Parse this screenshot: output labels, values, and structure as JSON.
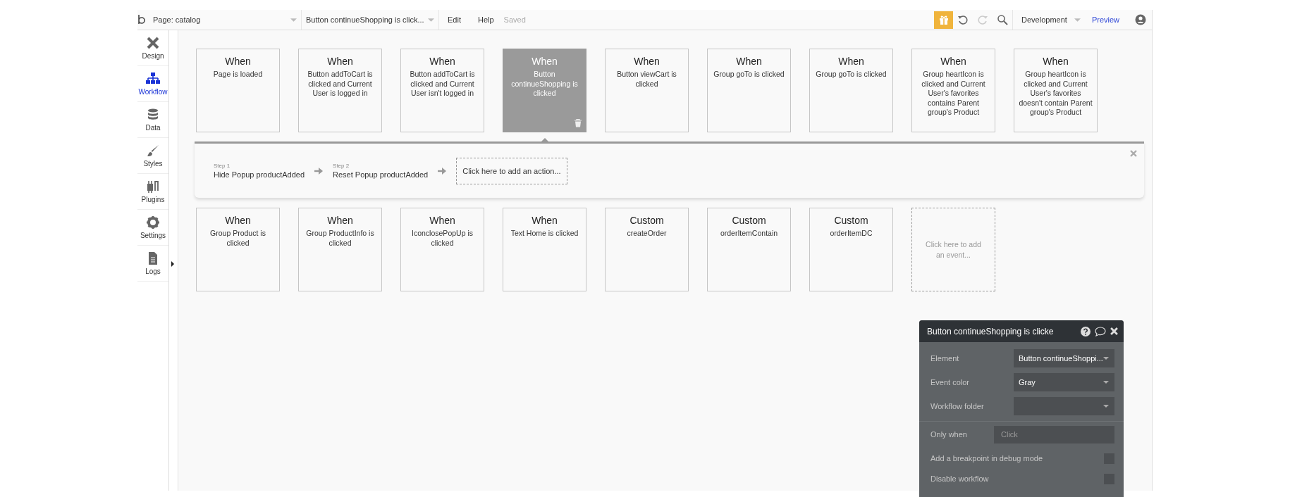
{
  "topbar": {
    "page_selector": "Page: catalog",
    "workflow_selector": "Button continueShopping is click...",
    "menu": [
      "Edit",
      "Help"
    ],
    "save_status": "Saved",
    "environment": "Development",
    "preview": "Preview"
  },
  "sidebar": {
    "items": [
      {
        "label": "Design",
        "selected": false
      },
      {
        "label": "Workflow",
        "selected": true
      },
      {
        "label": "Data",
        "selected": false
      },
      {
        "label": "Styles",
        "selected": false
      },
      {
        "label": "Plugins",
        "selected": false
      },
      {
        "label": "Settings",
        "selected": false
      },
      {
        "label": "Logs",
        "selected": false
      }
    ]
  },
  "event_rows": [
    {
      "events": [
        {
          "kind": "event",
          "heading": "When",
          "description": "Page is loaded",
          "selected": false
        },
        {
          "kind": "event",
          "heading": "When",
          "description": "Button addToCart is clicked and Current User is logged in",
          "selected": false
        },
        {
          "kind": "event",
          "heading": "When",
          "description": "Button addToCart is clicked and Current User isn't logged in",
          "selected": false
        },
        {
          "kind": "event",
          "heading": "When",
          "description": "Button continueShopping is clicked",
          "selected": true
        },
        {
          "kind": "event",
          "heading": "When",
          "description": "Button viewCart is clicked",
          "selected": false
        },
        {
          "kind": "event",
          "heading": "When",
          "description": "Group goTo is clicked",
          "selected": false
        },
        {
          "kind": "event",
          "heading": "When",
          "description": "Group goTo is clicked",
          "selected": false
        },
        {
          "kind": "event",
          "heading": "When",
          "description": "Group heartIcon is clicked and Current User's favorites contains Parent group's Product",
          "selected": false
        },
        {
          "kind": "event",
          "heading": "When",
          "description": "Group heartIcon is clicked and Current User's favorites doesn't contain Parent group's Product",
          "selected": false
        }
      ]
    },
    {
      "events": [
        {
          "kind": "event",
          "heading": "When",
          "description": "Group Product is clicked",
          "selected": false
        },
        {
          "kind": "event",
          "heading": "When",
          "description": "Group ProductInfo is clicked",
          "selected": false
        },
        {
          "kind": "event",
          "heading": "When",
          "description": "IconclosePopUp is clicked",
          "selected": false
        },
        {
          "kind": "event",
          "heading": "When",
          "description": "Text Home is clicked",
          "selected": false
        },
        {
          "kind": "event",
          "heading": "Custom",
          "description": "createOrder",
          "selected": false
        },
        {
          "kind": "event",
          "heading": "Custom",
          "description": "orderItemContain",
          "selected": false
        },
        {
          "kind": "event",
          "heading": "Custom",
          "description": "orderItemDC",
          "selected": false
        },
        {
          "kind": "add",
          "label": "Click here to add an event..."
        }
      ]
    }
  ],
  "steps_panel": {
    "steps": [
      {
        "number": "Step 1",
        "action": "Hide Popup productAdded"
      },
      {
        "number": "Step 2",
        "action": "Reset Popup productAdded"
      }
    ],
    "add_action": "Click here to add an action..."
  },
  "properties_panel": {
    "title": "Button continueShopping is clicke",
    "fields": [
      {
        "label": "Element",
        "value": "Button continueShoppi..."
      },
      {
        "label": "Event color",
        "value": "Gray"
      },
      {
        "label": "Workflow folder"
      }
    ],
    "only_when": {
      "label": "Only when",
      "placeholder": "Click"
    },
    "options": [
      {
        "label": "Add a breakpoint in debug mode",
        "checked": false
      },
      {
        "label": "Disable workflow",
        "checked": false
      }
    ]
  }
}
